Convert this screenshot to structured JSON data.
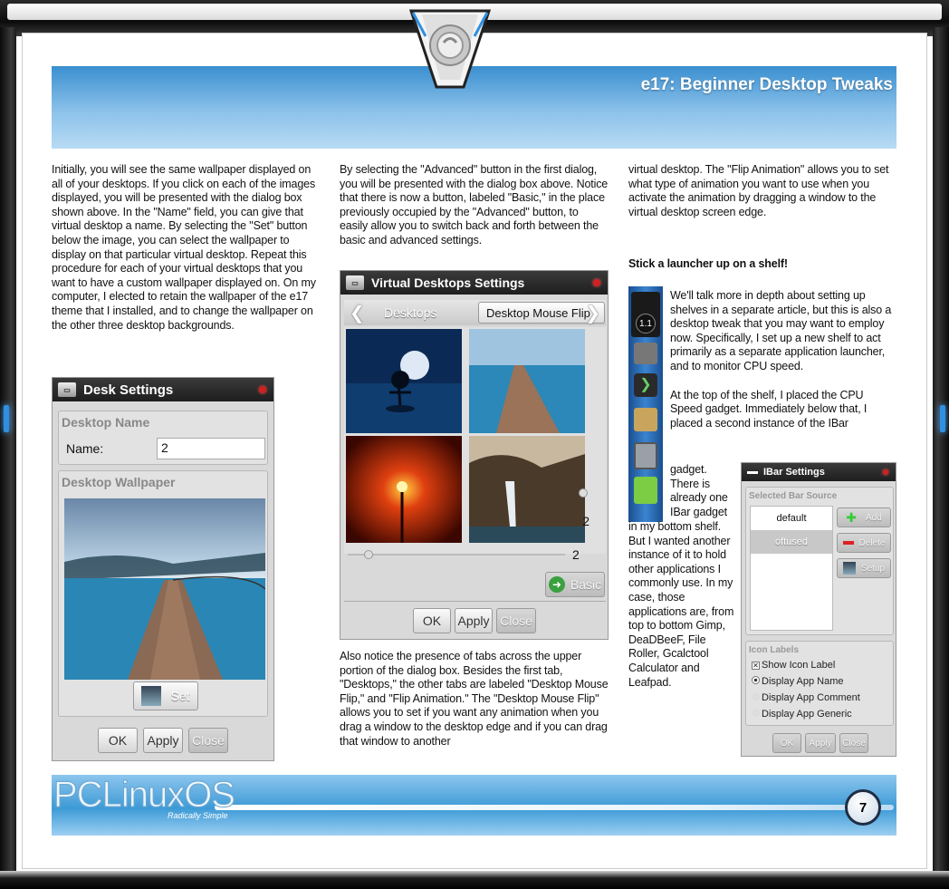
{
  "header": {
    "title": "e17: Beginner Desktop Tweaks"
  },
  "column1": {
    "paragraph": "Initially, you will see the same wallpaper displayed on all of your desktops. If you click on each of the images displayed, you will be presented with the dialog box shown above. In the \"Name\" field, you can give that virtual desktop a name. By selecting the \"Set\" button below the image, you can select the wallpaper to display on that particular virtual desktop. Repeat this procedure for each of your virtual desktops that you want to have a custom wallpaper displayed on. On my computer, I elected to retain the wallpaper of the e17 theme that I installed, and to change the wallpaper on the other three desktop backgrounds."
  },
  "column2": {
    "paragraph1": "By selecting the \"Advanced\" button in the first dialog, you will be presented with the dialog box above. Notice that there is now a button, labeled \"Basic,\" in the place previously occupied by the \"Advanced\" button, to easily allow you to switch back and forth between the basic and advanced settings.",
    "paragraph2": "Also notice the presence of tabs across the upper portion of the dialog box. Besides the first tab, \"Desktops,\" the other tabs are labeled \"Desktop Mouse Flip,\" and \"Flip Animation.\" The \"Desktop Mouse Flip\" allows you to set if you want any animation when you drag a window to the desktop edge and if you can drag that window to another"
  },
  "column3": {
    "paragraph1": "virtual desktop. The \"Flip Animation\" allows you to set what type of animation you want to use when you activate the animation by dragging a window to the virtual desktop screen edge.",
    "heading": "Stick a launcher up on a shelf!",
    "paragraph2": "We'll talk more in depth about setting up shelves in a separate article, but this is also a desktop tweak that you may want to employ now. Specifically, I set up a new shelf to act primarily as a separate application launcher, and to monitor CPU speed.",
    "paragraph3a": "At the top of the shelf, I placed the CPU Speed gadget. Immediately below that, I placed a second instance of the IBar",
    "paragraph3b_lines": [
      "gadget.",
      "There is",
      "already one",
      "IBar gadget"
    ],
    "paragraph3c_lines": [
      "in my bottom shelf.",
      "But I wanted another",
      "instance of it to hold",
      "other applications I",
      "commonly use. In my",
      "case, those",
      "applications are, from",
      "top to bottom Gimp,",
      "DeaDBeeF, File",
      "Roller, Gcalctool",
      "Calculator and",
      "Leafpad."
    ]
  },
  "desk_settings": {
    "title": "Desk Settings",
    "name_group": "Desktop Name",
    "name_label": "Name:",
    "name_value": "2",
    "wallpaper_group": "Desktop Wallpaper",
    "set_button": "Set",
    "ok": "OK",
    "apply": "Apply",
    "close": "Close"
  },
  "virtual_desktops": {
    "title": "Virtual Desktops Settings",
    "tabs": [
      "Desktops",
      "Desktop Mouse Flip"
    ],
    "vertical_value": "2",
    "horizontal_value": "2",
    "basic_button": "Basic",
    "ok": "OK",
    "apply": "Apply",
    "close": "Close"
  },
  "shelf": {
    "cpu_value": "1.1"
  },
  "ibar_settings": {
    "title": "IBar Settings",
    "source_group": "Selected Bar Source",
    "sources": [
      "default",
      "oftused"
    ],
    "add": "Add",
    "delete": "Delete",
    "setup": "Setup",
    "icon_labels_group": "Icon Labels",
    "options": [
      "Show Icon Label",
      "Display App Name",
      "Display App Comment",
      "Display App Generic"
    ],
    "ok": "OK",
    "apply": "Apply",
    "close": "Close"
  },
  "footer": {
    "logo": "PCLinuxOS",
    "tagline": "Radically Simple",
    "page_number": "7"
  },
  "colors": {
    "header_blue": "#5aa5dc",
    "footer_blue": "#3d9ad6",
    "close_red": "#d02020"
  }
}
